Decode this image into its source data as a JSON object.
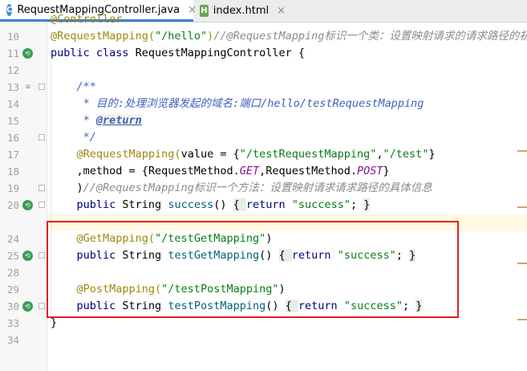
{
  "tabs": [
    {
      "label": "RequestMappingController.java",
      "icon": "java-class-icon",
      "close": "×",
      "active": true
    },
    {
      "label": "index.html",
      "icon": "html-file-icon",
      "close": "×",
      "active": false
    }
  ],
  "lines": [
    {
      "num": "",
      "tokens": [
        {
          "t": "@Controller",
          "c": "ann"
        }
      ]
    },
    {
      "num": "10",
      "tokens": [
        {
          "t": "@RequestMapping(",
          "c": "ann"
        },
        {
          "t": "\"/hello\"",
          "c": "str"
        },
        {
          "t": ")",
          "c": "ann"
        },
        {
          "t": "//@RequestMapping标识一个类：设置映射请求的请求路径的初始",
          "c": "cm"
        }
      ]
    },
    {
      "num": "11",
      "gutter": "bean",
      "tokens": [
        {
          "t": "public class ",
          "c": "kw"
        },
        {
          "t": "RequestMappingController {",
          "c": ""
        }
      ]
    },
    {
      "num": "12",
      "tokens": []
    },
    {
      "num": "13",
      "gutter": "doc",
      "fold": true,
      "tokens": [
        {
          "t": "    /**",
          "c": "dc"
        }
      ]
    },
    {
      "num": "14",
      "tokens": [
        {
          "t": "     * 目的:处理浏览器发起的域名:端口/hello/testRequestMapping",
          "c": "dc"
        }
      ]
    },
    {
      "num": "15",
      "tokens": [
        {
          "t": "     * ",
          "c": "dc"
        },
        {
          "t": "@return",
          "c": "dtag"
        }
      ]
    },
    {
      "num": "16",
      "fold": true,
      "tokens": [
        {
          "t": "     */",
          "c": "dc"
        }
      ]
    },
    {
      "num": "17",
      "tokens": [
        {
          "t": "    @RequestMapping(",
          "c": "ann"
        },
        {
          "t": "value = {",
          "c": ""
        },
        {
          "t": "\"/testRequestMapping\"",
          "c": "str"
        },
        {
          "t": ",",
          "c": ""
        },
        {
          "t": "\"/test\"",
          "c": "str"
        },
        {
          "t": "}",
          "c": ""
        }
      ]
    },
    {
      "num": "18",
      "tokens": [
        {
          "t": "    ,method = {RequestMethod.",
          "c": ""
        },
        {
          "t": "GET",
          "c": "fld"
        },
        {
          "t": ",RequestMethod.",
          "c": ""
        },
        {
          "t": "POST",
          "c": "fld"
        },
        {
          "t": "}",
          "c": ""
        }
      ]
    },
    {
      "num": "19",
      "fold": true,
      "tokens": [
        {
          "t": "    )",
          "c": ""
        },
        {
          "t": "//@RequestMapping标识一个方法：设置映射请求请求路径的具体信息",
          "c": "cm"
        }
      ]
    },
    {
      "num": "20",
      "gutter": "bean",
      "fold": true,
      "tokens": [
        {
          "t": "    ",
          "c": ""
        },
        {
          "t": "public ",
          "c": "kw"
        },
        {
          "t": "String ",
          "c": ""
        },
        {
          "t": "success",
          "c": "m"
        },
        {
          "t": "() ",
          "c": ""
        },
        {
          "t": "{ ",
          "c": "fb"
        },
        {
          "t": "return ",
          "c": "kw"
        },
        {
          "t": "\"success\"",
          "c": "str"
        },
        {
          "t": "; ",
          "c": ""
        },
        {
          "t": "}",
          "c": "fb"
        }
      ]
    },
    {
      "num": "",
      "caret": true,
      "tokens": []
    },
    {
      "num": "24",
      "tokens": [
        {
          "t": "    @GetMapping(",
          "c": "ann"
        },
        {
          "t": "\"/testGetMapping\"",
          "c": "str"
        },
        {
          "t": ")",
          "c": ""
        }
      ]
    },
    {
      "num": "25",
      "gutter": "bean",
      "fold": true,
      "tokens": [
        {
          "t": "    ",
          "c": ""
        },
        {
          "t": "public ",
          "c": "kw"
        },
        {
          "t": "String ",
          "c": ""
        },
        {
          "t": "testGetMapping",
          "c": "m"
        },
        {
          "t": "() ",
          "c": ""
        },
        {
          "t": "{ ",
          "c": "fb"
        },
        {
          "t": "return ",
          "c": "kw"
        },
        {
          "t": "\"success\"",
          "c": "str"
        },
        {
          "t": "; ",
          "c": ""
        },
        {
          "t": "}",
          "c": "fb"
        }
      ]
    },
    {
      "num": "28",
      "tokens": []
    },
    {
      "num": "29",
      "tokens": [
        {
          "t": "    @PostMapping(",
          "c": "ann"
        },
        {
          "t": "\"/testPostMapping\"",
          "c": "str"
        },
        {
          "t": ")",
          "c": ""
        }
      ]
    },
    {
      "num": "30",
      "gutter": "bean",
      "fold": true,
      "tokens": [
        {
          "t": "    ",
          "c": ""
        },
        {
          "t": "public ",
          "c": "kw"
        },
        {
          "t": "String ",
          "c": ""
        },
        {
          "t": "testPostMapping",
          "c": "m"
        },
        {
          "t": "() ",
          "c": ""
        },
        {
          "t": "{ ",
          "c": "fb"
        },
        {
          "t": "return ",
          "c": "kw"
        },
        {
          "t": "\"success\"",
          "c": "str"
        },
        {
          "t": "; ",
          "c": ""
        },
        {
          "t": "}",
          "c": "fb"
        }
      ]
    },
    {
      "num": "33",
      "tokens": [
        {
          "t": "}",
          "c": ""
        }
      ]
    },
    {
      "num": "34",
      "tokens": []
    },
    {
      "num": "",
      "tokens": []
    }
  ]
}
